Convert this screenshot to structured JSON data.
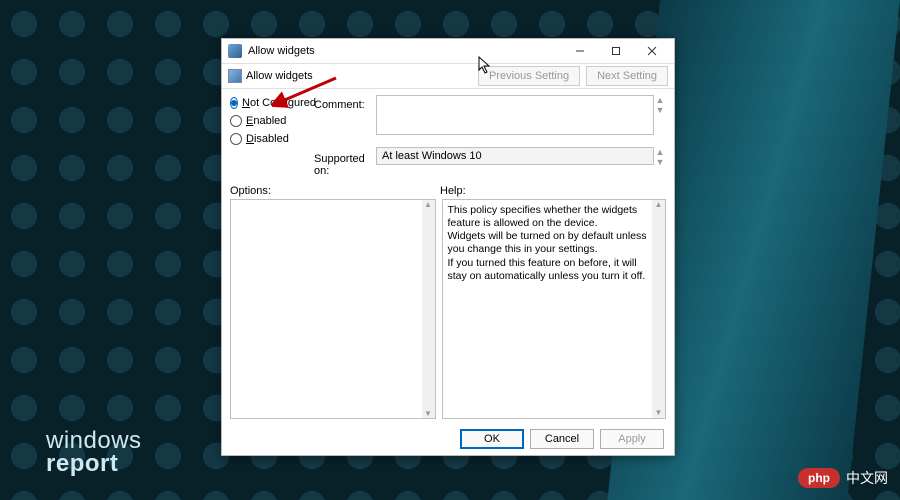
{
  "window": {
    "title": "Allow widgets",
    "policy_name": "Allow widgets"
  },
  "nav": {
    "previous": "Previous Setting",
    "next": "Next Setting"
  },
  "state": {
    "selected": "not_configured",
    "not_configured_prefix": "N",
    "not_configured_rest": "ot Configured",
    "enabled_prefix": "E",
    "enabled_rest": "nabled",
    "disabled_prefix": "D",
    "disabled_rest": "isabled"
  },
  "labels": {
    "comment": "Comment:",
    "supported": "Supported on:",
    "options": "Options:",
    "help": "Help:"
  },
  "supported_on": "At least Windows 10",
  "help_text": {
    "p1": "This policy specifies whether the widgets feature is allowed on the device.",
    "p2": "Widgets will be turned on by default unless you change this in your settings.",
    "p3": "If you turned this feature on before, it will stay on automatically unless you turn it off."
  },
  "buttons": {
    "ok": "OK",
    "cancel": "Cancel",
    "apply": "Apply"
  },
  "watermarks": {
    "left_line1": "windows",
    "left_line2": "report",
    "right_pill": "php",
    "right_text": "中文网"
  }
}
